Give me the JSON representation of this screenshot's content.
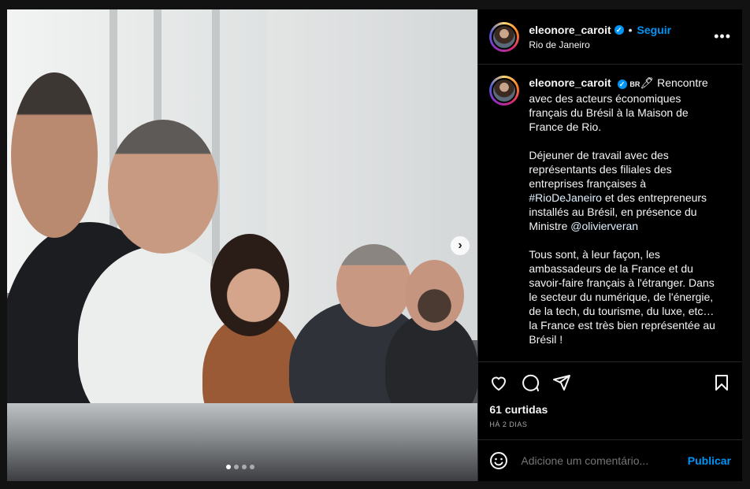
{
  "post": {
    "username": "eleonore_caroit",
    "follow_label": "Seguir",
    "separator": "•",
    "location": "Rio de Janeiro",
    "more_label": "•••",
    "next_label": "›",
    "caption_tag": "BR",
    "caption_part1": "Rencontre avec des acteurs économiques français du Brésil à la Maison de France de Rio.\n\nDéjeuner de travail avec des représentants des filiales des entreprises françaises à ",
    "hashtag": "#RioDeJaneiro",
    "caption_part2": " et des entrepreneurs installés au Brésil, en présence du Ministre ",
    "mention": "@olivierveran",
    "caption_part3": "\n\nTous sont, à leur façon, les ambassadeurs de la France et du savoir-faire français à l'étranger. Dans le secteur du numérique, de l'énergie, de la tech, du tourisme, du luxe, etc… la France est très bien représentée au Brésil !",
    "likes": "61 curtidas",
    "time": "HÁ 2 DIAS",
    "comment_placeholder": "Adicione um comentário...",
    "publish_label": "Publicar",
    "carousel_count": 4,
    "carousel_active": 0
  },
  "colors": {
    "accent": "#0095f6",
    "background": "#000000"
  }
}
